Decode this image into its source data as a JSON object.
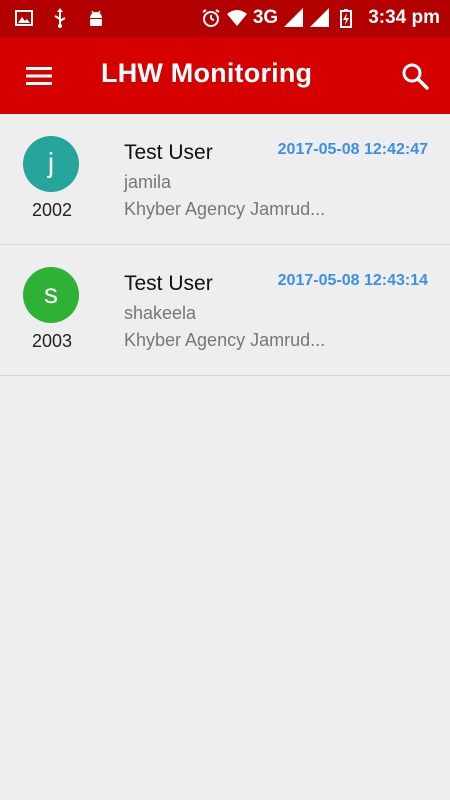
{
  "status_bar": {
    "icons_left": [
      "image-icon",
      "usb-icon",
      "android-icon"
    ],
    "network": "3G",
    "time": "3:34 pm"
  },
  "app_bar": {
    "title": "LHW Monitoring"
  },
  "colors": {
    "status_bar": "#b30000",
    "app_bar": "#d50000",
    "timestamp": "#3d8fe6",
    "avatar_teal": "#26a69a",
    "avatar_green": "#2eb135"
  },
  "records": [
    {
      "initial": "j",
      "id": "2002",
      "name": "Test User",
      "username": "jamila",
      "location": "Khyber Agency Jamrud...",
      "timestamp": "2017-05-08 12:42:47"
    },
    {
      "initial": "s",
      "id": "2003",
      "name": "Test User",
      "username": "shakeela",
      "location": "Khyber Agency Jamrud...",
      "timestamp": "2017-05-08 12:43:14"
    }
  ]
}
